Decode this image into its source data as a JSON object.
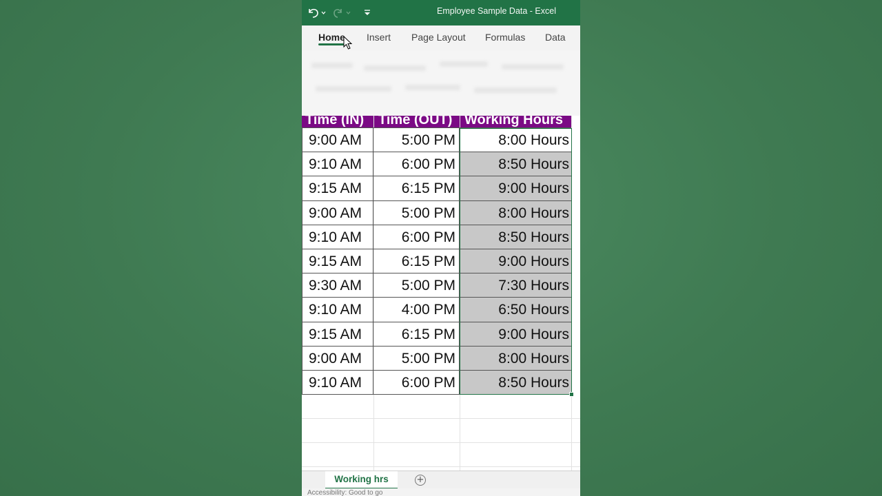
{
  "app": {
    "title": "Employee Sample Data  -  Excel",
    "accent_color": "#217346",
    "header_color": "#7b0a85",
    "selection_fill": "#c8c8c8"
  },
  "quick_access": {
    "undo_icon": "undo-icon",
    "redo_icon": "redo-icon",
    "customize_icon": "customize-toolbar-icon"
  },
  "ribbon": {
    "tabs": [
      {
        "label": "Home",
        "active": true
      },
      {
        "label": "Insert"
      },
      {
        "label": "Page Layout"
      },
      {
        "label": "Formulas"
      },
      {
        "label": "Data"
      }
    ]
  },
  "sheet": {
    "headers": [
      "Time (IN)",
      "Time (OUT)",
      "Working Hours"
    ],
    "rows": [
      [
        "9:00 AM",
        "5:00 PM",
        "8:00 Hours"
      ],
      [
        "9:10 AM",
        "6:00 PM",
        "8:50 Hours"
      ],
      [
        "9:15 AM",
        "6:15 PM",
        "9:00 Hours"
      ],
      [
        "9:00 AM",
        "5:00 PM",
        "8:00 Hours"
      ],
      [
        "9:10 AM",
        "6:00 PM",
        "8:50 Hours"
      ],
      [
        "9:15 AM",
        "6:15 PM",
        "9:00 Hours"
      ],
      [
        "9:30 AM",
        "5:00 PM",
        "7:30 Hours"
      ],
      [
        "9:10 AM",
        "4:00 PM",
        "6:50 Hours"
      ],
      [
        "9:15 AM",
        "6:15 PM",
        "9:00 Hours"
      ],
      [
        "9:00 AM",
        "5:00 PM",
        "8:00 Hours"
      ],
      [
        "9:10 AM",
        "6:00 PM",
        "8:50 Hours"
      ]
    ]
  },
  "sheet_tabs": {
    "active": "Working hrs",
    "add_icon": "add-sheet-icon"
  },
  "status": {
    "text": "Accessibility: Good to go"
  }
}
